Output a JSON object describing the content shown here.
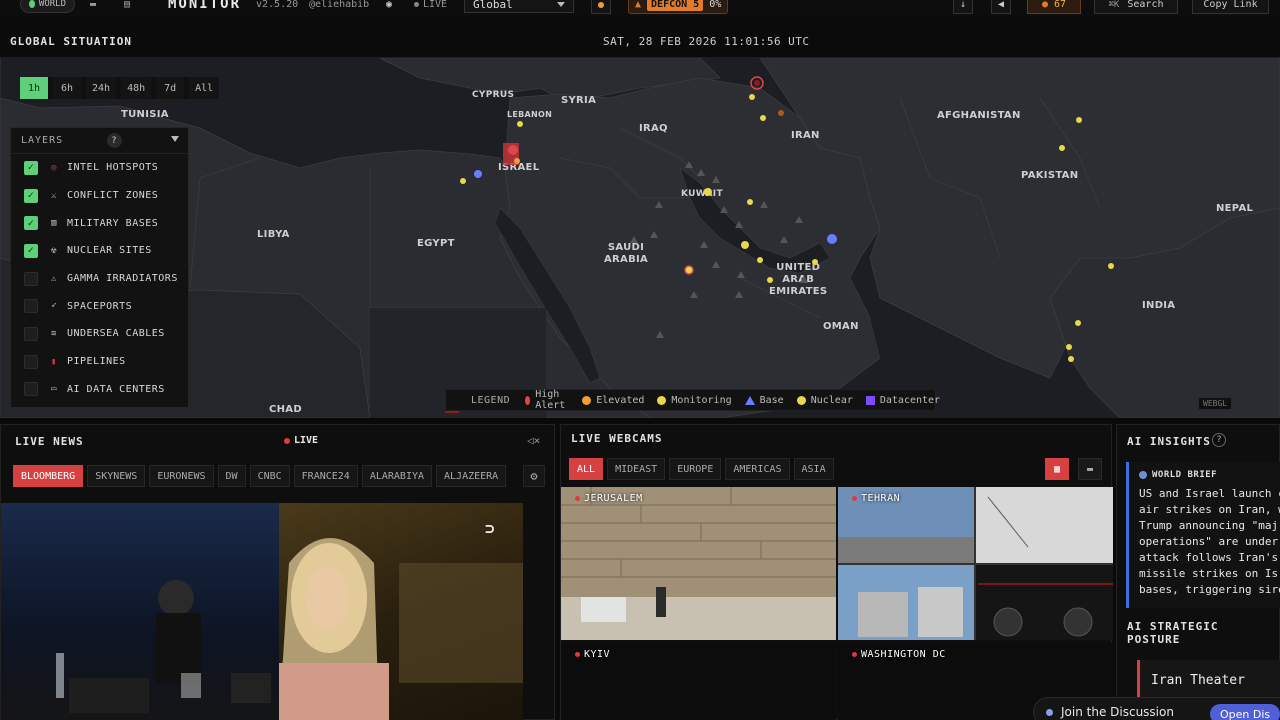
{
  "topbar": {
    "world_label": "WORLD",
    "brand": "MONITOR",
    "version": "v2.5.20",
    "handle": "@eliehabib",
    "live_label": "LIVE",
    "region": "Global",
    "defcon_level": "DEFCON 5",
    "defcon_pct": "0%",
    "alerts_count": "67",
    "search_label": "Search",
    "search_shortcut": "⌘K",
    "copy_link": "Copy Link"
  },
  "situation": {
    "title": "GLOBAL SITUATION",
    "clock": "SAT, 28 FEB 2026 11:01:56 UTC",
    "time_filters": [
      {
        "label": "1h",
        "active": true
      },
      {
        "label": "6h"
      },
      {
        "label": "24h"
      },
      {
        "label": "48h"
      },
      {
        "label": "7d"
      },
      {
        "label": "All"
      }
    ]
  },
  "layers": {
    "title": "LAYERS",
    "help": "?",
    "items": [
      {
        "label": "INTEL HOTSPOTS",
        "checked": true,
        "icon": "target-icon"
      },
      {
        "label": "CONFLICT ZONES",
        "checked": true,
        "icon": "swords-icon"
      },
      {
        "label": "MILITARY BASES",
        "checked": true,
        "icon": "building-icon"
      },
      {
        "label": "NUCLEAR SITES",
        "checked": true,
        "icon": "radiation-icon"
      },
      {
        "label": "GAMMA IRRADIATORS",
        "checked": false,
        "icon": "warning-icon"
      },
      {
        "label": "SPACEPORTS",
        "checked": false,
        "icon": "rocket-icon"
      },
      {
        "label": "UNDERSEA CABLES",
        "checked": false,
        "icon": "cable-icon"
      },
      {
        "label": "PIPELINES",
        "checked": false,
        "icon": "pipe-icon"
      },
      {
        "label": "AI DATA CENTERS",
        "checked": false,
        "icon": "server-icon"
      }
    ]
  },
  "map": {
    "countries": {
      "tunisia": "TUNISIA",
      "cyprus": "CYPRUS",
      "syria": "SYRIA",
      "lebanon": "LEBANON",
      "iraq": "IRAQ",
      "iran": "IRAN",
      "afghanistan": "AFGHANISTAN",
      "israel": "ISRAEL",
      "libya": "LIBYA",
      "egypt": "EGYPT",
      "kuwait": "KUWAIT",
      "saudi": "SAUDI\nARABIA",
      "pakistan": "PAKISTAN",
      "nepal": "NEPAL",
      "uae": "UNITED\nARAB\nEMIRATES",
      "oman": "OMAN",
      "india": "INDIA",
      "chad": "CHAD"
    },
    "legend": {
      "title": "LEGEND",
      "items": [
        {
          "label": "High Alert",
          "color": "#e0454c"
        },
        {
          "label": "Elevated",
          "color": "#f0a030"
        },
        {
          "label": "Monitoring",
          "color": "#e8d84a"
        },
        {
          "label": "Base",
          "color": "#6a7cff"
        },
        {
          "label": "Nuclear",
          "color": "#e8d84a"
        },
        {
          "label": "Datacenter",
          "color": "#7c4dff"
        }
      ]
    },
    "renderer": "WEBGL"
  },
  "news": {
    "title": "LIVE NEWS",
    "live": "LIVE",
    "channels": [
      {
        "label": "BLOOMBERG",
        "active": true
      },
      {
        "label": "SKYNEWS"
      },
      {
        "label": "EURONEWS"
      },
      {
        "label": "DW"
      },
      {
        "label": "CNBC"
      },
      {
        "label": "FRANCE24"
      },
      {
        "label": "ALARABIYA"
      },
      {
        "label": "ALJAZEERA"
      }
    ]
  },
  "webcams": {
    "title": "LIVE WEBCAMS",
    "filters": [
      {
        "label": "ALL",
        "active": true
      },
      {
        "label": "MIDEAST"
      },
      {
        "label": "EUROPE"
      },
      {
        "label": "AMERICAS"
      },
      {
        "label": "ASIA"
      }
    ],
    "cams": [
      "JERUSALEM",
      "TEHRAN",
      "KYIV",
      "WASHINGTON DC"
    ]
  },
  "insights": {
    "title": "AI INSIGHTS",
    "brief_title": "WORLD BRIEF",
    "brief_text": "US and Israel launch c\nair strikes on Iran, w\nTrump announcing \"maj\noperations\" are under\nattack follows Iran's\nmissile strikes on Isr\nbases, triggering sire",
    "posture_title": "AI STRATEGIC POSTURE",
    "theater": "Iran Theater"
  },
  "discussion": {
    "label": "Join the Discussion",
    "open": "Open Dis"
  },
  "colors": {
    "accent_green": "#5ed07a",
    "alert_red": "#d64040",
    "brief_blue": "#3b6fe0"
  }
}
